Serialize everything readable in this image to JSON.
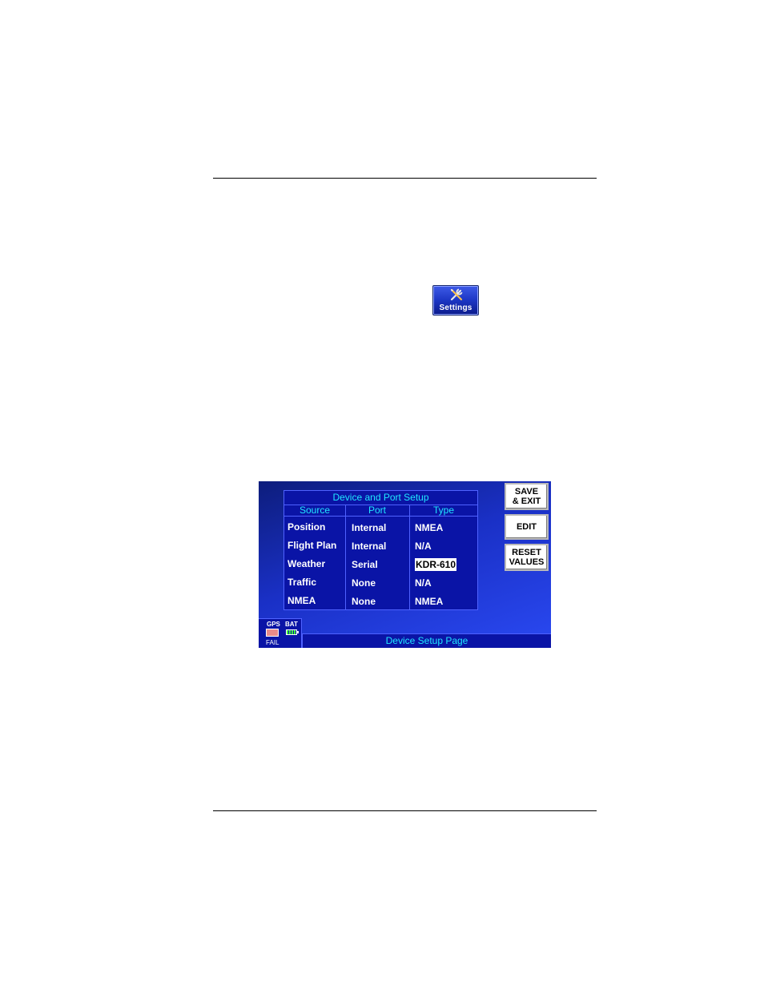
{
  "settings_icon": {
    "label": "Settings"
  },
  "device": {
    "panel_title": "Device and Port Setup",
    "columns": [
      "Source",
      "Port",
      "Type"
    ],
    "rows": [
      {
        "source": "Position",
        "port": "Internal",
        "type": "NMEA"
      },
      {
        "source": "Flight Plan",
        "port": "Internal",
        "type": "N/A"
      },
      {
        "source": "Weather",
        "port": "Serial",
        "type": "KDR-610"
      },
      {
        "source": "Traffic",
        "port": "None",
        "type": "N/A"
      },
      {
        "source": "NMEA",
        "port": "None",
        "type": "NMEA"
      }
    ],
    "buttons": {
      "save_exit_line1": "SAVE",
      "save_exit_line2": "& EXIT",
      "edit": "EDIT",
      "reset_line1": "RESET",
      "reset_line2": "VALUES"
    },
    "status": {
      "gps_label": "GPS",
      "bat_label": "BAT",
      "fail_label": "FAIL"
    },
    "footer": "Device Setup Page",
    "colors": {
      "screen_blue": "#1a30c6",
      "panel_blue": "#0a14a6",
      "cyan_text": "#20e6ff"
    },
    "icons": [
      "wrench-screwdriver-icon",
      "gps-receiver-icon",
      "battery-icon"
    ]
  }
}
